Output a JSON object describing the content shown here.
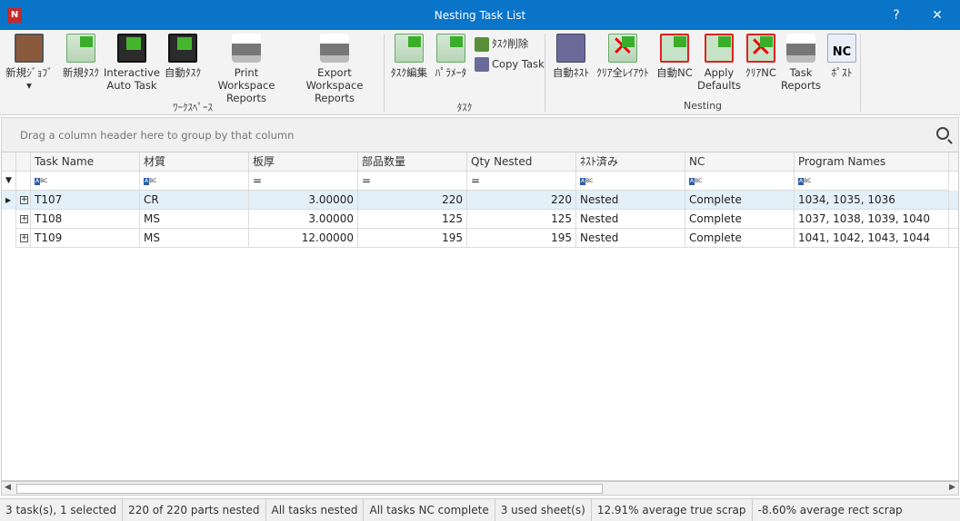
{
  "window": {
    "title": "Nesting Task List",
    "help": "?",
    "close": "✕"
  },
  "ribbon": {
    "workspace": {
      "label": "ﾜｰｸｽﾍﾟｰｽ",
      "new_job": "新規ｼﾞｮﾌﾞ",
      "new_task": "新規ﾀｽｸ",
      "interactive_auto_task": [
        "Interactive",
        "Auto Task"
      ],
      "auto_task": "自動ﾀｽｸ",
      "print_workspace_reports": [
        "Print Workspace",
        "Reports"
      ],
      "export_workspace_reports": [
        "Export Workspace",
        "Reports"
      ]
    },
    "task": {
      "label": "ﾀｽｸ",
      "edit_task": "ﾀｽｸ編集",
      "parameters": "ﾊﾟﾗﾒｰﾀ",
      "delete_task": "ﾀｽｸ削除",
      "copy_task": "Copy Task"
    },
    "nesting": {
      "label": "Nesting",
      "auto_nest": "自動ﾈｽﾄ",
      "clear_all_layouts": "ｸﾘｱ全ﾚｲｱｳﾄ",
      "auto_nc": "自動NC",
      "apply_defaults": [
        "Apply",
        "Defaults"
      ],
      "clear_nc": "ｸﾘｱNC",
      "task_reports": [
        "Task",
        "Reports"
      ],
      "post": "ﾎﾟｽﾄ",
      "nc_icon_text": "NC"
    }
  },
  "grid": {
    "group_hint": "Drag a column header here to group by that column",
    "columns": [
      "Task Name",
      "材質",
      "板厚",
      "部品数量",
      "Qty Nested",
      "ﾈｽﾄ済み",
      "NC",
      "Program Names"
    ],
    "filter_abc": "A",
    "filter_abc_rest": "BC",
    "filter_eq": "=",
    "rows": [
      {
        "task": "T107",
        "material": "CR",
        "thickness": "3.00000",
        "qty": "220",
        "qty_nested": "220",
        "nested": "Nested",
        "nc": "Complete",
        "programs": "1034, 1035, 1036",
        "selected": true
      },
      {
        "task": "T108",
        "material": "MS",
        "thickness": "3.00000",
        "qty": "125",
        "qty_nested": "125",
        "nested": "Nested",
        "nc": "Complete",
        "programs": "1037, 1038, 1039, 1040",
        "selected": false
      },
      {
        "task": "T109",
        "material": "MS",
        "thickness": "12.00000",
        "qty": "195",
        "qty_nested": "195",
        "nested": "Nested",
        "nc": "Complete",
        "programs": "1041, 1042, 1043, 1044",
        "selected": false
      }
    ]
  },
  "status": [
    "3 task(s), 1 selected",
    "220 of 220 parts nested",
    "All tasks nested",
    "All tasks NC complete",
    "3 used sheet(s)",
    "12.91% average true scrap",
    "-8.60% average rect scrap"
  ],
  "colors": {
    "titlebar": "#0a74c9",
    "selected_row": "#e3f0fa"
  }
}
